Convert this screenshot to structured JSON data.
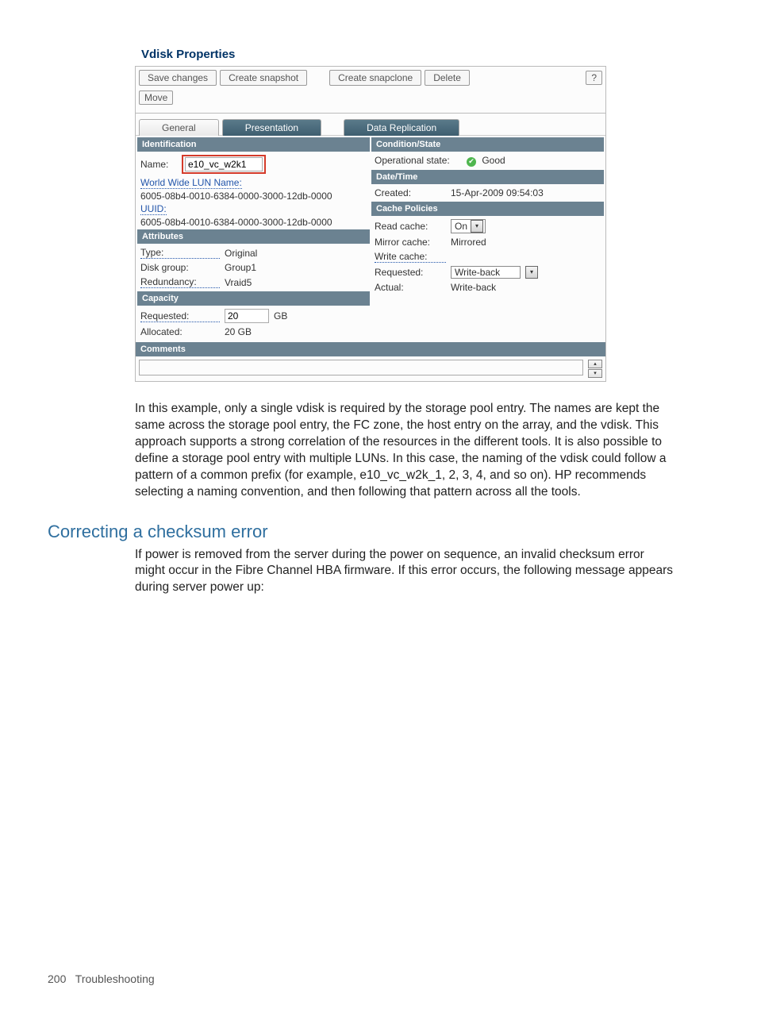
{
  "screenshot": {
    "title": "Vdisk Properties",
    "buttons": {
      "save": "Save changes",
      "snapshot": "Create snapshot",
      "snapclone": "Create snapclone",
      "delete": "Delete",
      "help": "?",
      "move": "Move"
    },
    "tabs": {
      "general": "General",
      "presentation": "Presentation",
      "replication": "Data Replication"
    },
    "left": {
      "identification": {
        "header": "Identification",
        "name_label": "Name:",
        "name_value": "e10_vc_w2k1",
        "wwln_label": "World Wide LUN Name:",
        "wwln_value": "6005-08b4-0010-6384-0000-3000-12db-0000",
        "uuid_label": "UUID:",
        "uuid_value": "6005-08b4-0010-6384-0000-3000-12db-0000"
      },
      "attributes": {
        "header": "Attributes",
        "type_label": "Type:",
        "type_value": "Original",
        "dg_label": "Disk group:",
        "dg_value": "Group1",
        "red_label": "Redundancy:",
        "red_value": "Vraid5"
      },
      "capacity": {
        "header": "Capacity",
        "req_label": "Requested:",
        "req_value": "20",
        "req_unit": "GB",
        "alloc_label": "Allocated:",
        "alloc_value": "20 GB"
      }
    },
    "right": {
      "condition": {
        "header": "Condition/State",
        "op_label": "Operational state:",
        "op_value": "Good"
      },
      "datetime": {
        "header": "Date/Time",
        "created_label": "Created:",
        "created_value": "15-Apr-2009 09:54:03"
      },
      "cache": {
        "header": "Cache Policies",
        "read_label": "Read cache:",
        "read_value": "On",
        "mirror_label": "Mirror cache:",
        "mirror_value": "Mirrored",
        "write_label": "Write cache:",
        "req_label": "Requested:",
        "req_value": "Write-back",
        "actual_label": "Actual:",
        "actual_value": "Write-back"
      }
    },
    "comments": {
      "header": "Comments"
    }
  },
  "body": {
    "para1": "In this example, only a single vdisk is required by the storage pool entry. The names are kept the same across the storage pool entry, the FC zone, the host entry on the array, and the vdisk. This approach supports a strong correlation of the resources in the different tools. It is also possible to define a storage pool entry with multiple LUNs. In this case, the naming of the vdisk could follow a pattern of a common prefix (for example, e10_vc_w2k_1, 2, 3, 4, and so on). HP recommends selecting a naming convention, and then following that pattern across all the tools.",
    "h2": "Correcting a checksum error",
    "para2": "If power is removed from the server during the power on sequence, an invalid checksum error might occur in the Fibre Channel HBA firmware. If this error occurs, the following message appears during server power up:"
  },
  "footer": {
    "page": "200",
    "section": "Troubleshooting"
  }
}
